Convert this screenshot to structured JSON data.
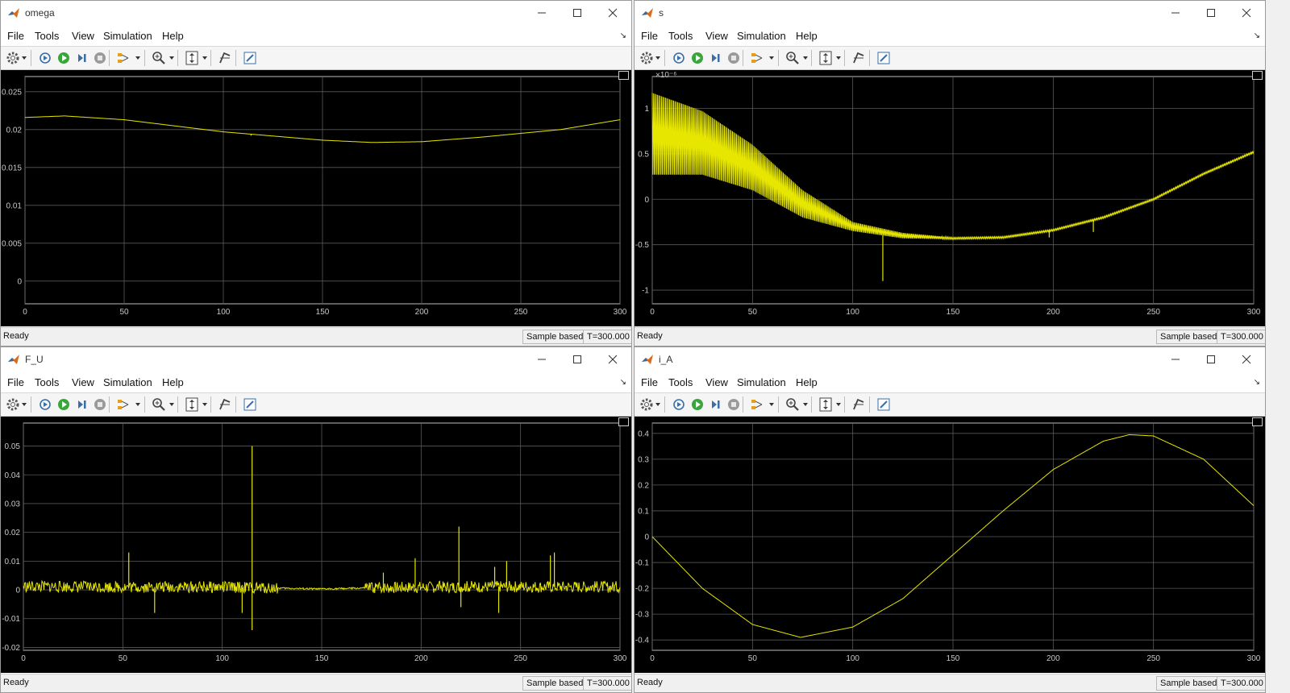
{
  "menu": [
    "File",
    "Tools",
    "View",
    "Simulation",
    "Help"
  ],
  "status": {
    "ready": "Ready",
    "mode": "Sample based",
    "time": "T=300.000"
  },
  "colors": {
    "trace": "#e6e600",
    "grid": "#5a5a5a",
    "axes_bg": "#000000",
    "tick_text": "#c8c8c8"
  },
  "icons": [
    "settings-icon",
    "step-back-icon",
    "run-icon",
    "step-forward-icon",
    "stop-icon",
    "signal-select-icon",
    "zoom-icon",
    "autoscale-icon",
    "cursor-icon",
    "edit-icon"
  ],
  "windows": [
    {
      "title": "omega",
      "ylim": [
        -0.003,
        0.027
      ],
      "yticks": [
        0,
        0.005,
        0.01,
        0.015,
        0.02,
        0.025
      ],
      "ytick_labels": [
        "0",
        "0.005",
        "0.01",
        "0.015",
        "0.02",
        "0.025"
      ],
      "exponent": ""
    },
    {
      "title": "s",
      "ylim": [
        -1.15,
        1.35
      ],
      "yticks": [
        -1,
        -0.5,
        0,
        0.5,
        1
      ],
      "ytick_labels": [
        "-1",
        "-0.5",
        "0",
        "0.5",
        "1"
      ],
      "exponent": "×10⁻⁶"
    },
    {
      "title": "F_U",
      "ylim": [
        -0.021,
        0.058
      ],
      "yticks": [
        -0.02,
        -0.01,
        0,
        0.01,
        0.02,
        0.03,
        0.04,
        0.05
      ],
      "ytick_labels": [
        "-0.02",
        "-0.01",
        "0",
        "0.01",
        "0.02",
        "0.03",
        "0.04",
        "0.05"
      ],
      "exponent": ""
    },
    {
      "title": "i_A",
      "ylim": [
        -0.44,
        0.44
      ],
      "yticks": [
        -0.4,
        -0.3,
        -0.2,
        -0.1,
        0,
        0.1,
        0.2,
        0.3,
        0.4
      ],
      "ytick_labels": [
        "-0.4",
        "-0.3",
        "-0.2",
        "-0.1",
        "0",
        "0.1",
        "0.2",
        "0.3",
        "0.4"
      ],
      "exponent": ""
    }
  ],
  "xaxis": {
    "xlim": [
      0,
      300
    ],
    "xticks": [
      0,
      50,
      100,
      150,
      200,
      250,
      300
    ],
    "xtick_labels": [
      "0",
      "50",
      "100",
      "150",
      "200",
      "250",
      "300"
    ]
  },
  "chart_data": [
    {
      "type": "line",
      "title": "omega",
      "series": [
        {
          "x": [
            0,
            20,
            50,
            100,
            150,
            175,
            200,
            230,
            270,
            300
          ],
          "y": [
            0.0216,
            0.0218,
            0.0213,
            0.0197,
            0.0186,
            0.0183,
            0.0184,
            0.019,
            0.02,
            0.0213
          ]
        }
      ],
      "spikes": [
        {
          "x": 114,
          "y": 0.0192
        }
      ],
      "xlim": [
        0,
        300
      ],
      "ylim": [
        -0.003,
        0.027
      ]
    },
    {
      "type": "line",
      "title": "s",
      "series": [
        {
          "x": [
            0,
            25,
            50,
            75,
            100,
            125,
            150,
            175,
            200,
            225,
            250,
            275,
            300
          ],
          "y": [
            0.72,
            0.62,
            0.35,
            -0.05,
            -0.3,
            -0.4,
            -0.43,
            -0.42,
            -0.34,
            -0.2,
            0.0,
            0.28,
            0.52
          ]
        }
      ],
      "oscillation_amplitude": [
        {
          "x": 0,
          "a": 0.45
        },
        {
          "x": 50,
          "a": 0.25
        },
        {
          "x": 100,
          "a": 0.05
        },
        {
          "x": 150,
          "a": 0.01
        }
      ],
      "spikes": [
        {
          "x": 115,
          "y": -0.9
        },
        {
          "x": 198,
          "y": -0.42
        },
        {
          "x": 220,
          "y": -0.36
        }
      ],
      "xlim": [
        0,
        300
      ],
      "ylim": [
        -1.15,
        1.35
      ]
    },
    {
      "type": "line",
      "title": "F_U",
      "series": [
        {
          "x": [
            0,
            50,
            100,
            150,
            175,
            200,
            250,
            300
          ],
          "y": [
            0.0012,
            0.001,
            0.001,
            0.0003,
            0.0007,
            0.001,
            0.0012,
            0.001
          ]
        }
      ],
      "spikes": [
        {
          "x": 53,
          "y": 0.013
        },
        {
          "x": 66,
          "y": -0.008
        },
        {
          "x": 110,
          "y": -0.008
        },
        {
          "x": 115,
          "y": 0.05
        },
        {
          "x": 115,
          "y": -0.014
        },
        {
          "x": 197,
          "y": 0.011
        },
        {
          "x": 219,
          "y": 0.022
        },
        {
          "x": 220,
          "y": -0.006
        },
        {
          "x": 237,
          "y": 0.008
        },
        {
          "x": 239,
          "y": -0.008
        },
        {
          "x": 243,
          "y": 0.01
        },
        {
          "x": 265,
          "y": 0.012
        },
        {
          "x": 267,
          "y": 0.013
        },
        {
          "x": 181,
          "y": 0.006
        }
      ],
      "xlim": [
        0,
        300
      ],
      "ylim": [
        -0.021,
        0.058
      ]
    },
    {
      "type": "line",
      "title": "i_A",
      "series": [
        {
          "x": [
            0,
            25,
            50,
            74,
            100,
            125,
            150,
            175,
            200,
            225,
            238,
            250,
            275,
            300
          ],
          "y": [
            0.0,
            -0.2,
            -0.34,
            -0.39,
            -0.35,
            -0.24,
            -0.07,
            0.1,
            0.26,
            0.37,
            0.395,
            0.39,
            0.3,
            0.12
          ]
        }
      ],
      "xlim": [
        0,
        300
      ],
      "ylim": [
        -0.44,
        0.44
      ]
    }
  ]
}
